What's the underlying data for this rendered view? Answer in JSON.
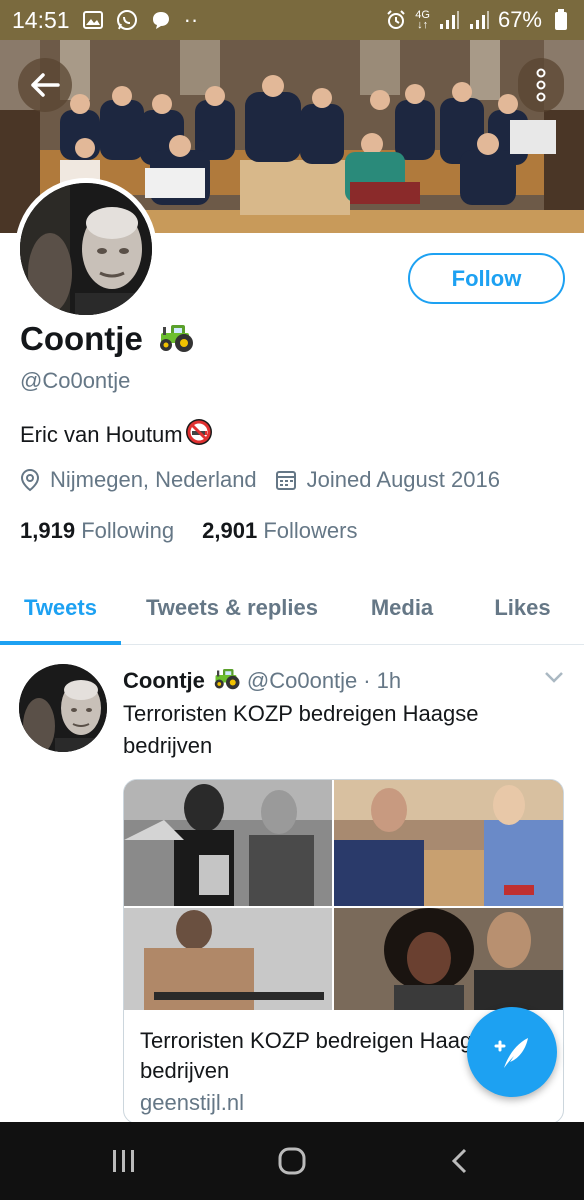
{
  "status_bar": {
    "time": "14:51",
    "network_top": "4G",
    "battery": "67%",
    "dots": "··"
  },
  "profile": {
    "display_name": "Coontje",
    "name_emoji": "tractor-icon",
    "handle": "@Co0ontje",
    "bio": "Eric van Houtum",
    "bio_emoji": "no-smoking-icon",
    "location": "Nijmegen, Nederland",
    "joined": "Joined August 2016",
    "following_count": "1,919",
    "following_label": "Following",
    "followers_count": "2,901",
    "followers_label": "Followers",
    "follow_button": "Follow"
  },
  "tabs": [
    {
      "label": "Tweets",
      "active": true
    },
    {
      "label": "Tweets & replies",
      "active": false
    },
    {
      "label": "Media",
      "active": false
    },
    {
      "label": "Likes",
      "active": false
    }
  ],
  "tweet": {
    "name": "Coontje",
    "handle": "@Co0ontje",
    "dot": "·",
    "time": "1h",
    "text": "Terroristen KOZP bedreigen Haagse bedrijven",
    "card": {
      "title": "Terroristen KOZP bedreigen Haagse bedrijven",
      "domain": "geenstijl.nl"
    }
  },
  "colors": {
    "accent": "#1da1f2",
    "secondary_text": "#657786",
    "status_bar": "#7a6a3e",
    "nav_bar": "#111111"
  },
  "icons": {
    "back": "arrow-left-icon",
    "more": "more-vertical-icon",
    "location": "location-pin-icon",
    "calendar": "calendar-icon",
    "caret": "chevron-down-icon",
    "compose": "compose-feather-icon",
    "nav_recent": "recent-apps-icon",
    "nav_home": "home-icon",
    "nav_back": "back-icon"
  }
}
